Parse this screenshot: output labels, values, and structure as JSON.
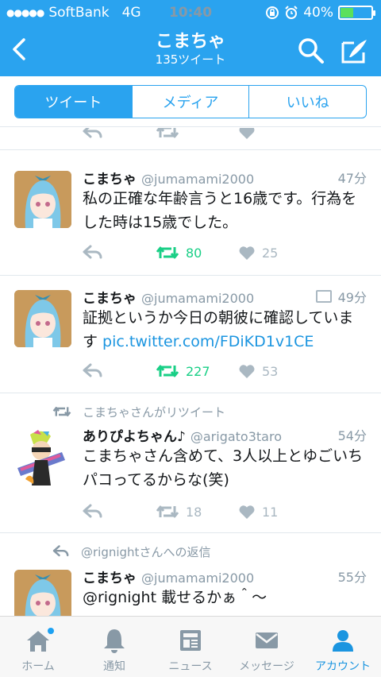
{
  "status_bar": {
    "signal": "●●●●●",
    "carrier": "SoftBank",
    "network": "4G",
    "time": "10:40",
    "battery": "40%",
    "battery_level": 0.4
  },
  "nav": {
    "title": "こまちゃ",
    "subtitle": "135ツイート"
  },
  "segments": [
    {
      "label": "ツイート",
      "active": true
    },
    {
      "label": "メディア",
      "active": false
    },
    {
      "label": "いいね",
      "active": false
    }
  ],
  "tweets": [
    {
      "name": "こまちゃ",
      "handle": "@jumamami2000",
      "time": "47分",
      "text": "私の正確な年齢言うと16歳です。行為をした時は15歳でした。",
      "retweets": "80",
      "likes": "25"
    },
    {
      "name": "こまちゃ",
      "handle": "@jumamami2000",
      "time": "49分",
      "text": "証拠というか今日の朝彼に確認しています ",
      "link": "pic.twitter.com/FDiKD1v1CE",
      "retweets": "227",
      "likes": "53"
    },
    {
      "context": "こまちゃさんがリツイート",
      "name": "ありぴよちゃん♪",
      "handle": "@arigato3taro",
      "time": "54分",
      "text": "こまちゃさん含めて、3人以上とゆごいちパコってるからな(笑)",
      "retweets": "18",
      "likes": "11"
    },
    {
      "context": "@rignightさんへの返信",
      "name": "こまちゃ",
      "handle": "@jumamami2000",
      "time": "55分",
      "text": "@rignight 載せるかぁ＾〜"
    }
  ],
  "tabs": [
    {
      "label": "ホーム",
      "icon": "home-icon",
      "badge": true
    },
    {
      "label": "通知",
      "icon": "bell-icon"
    },
    {
      "label": "ニュース",
      "icon": "news-icon"
    },
    {
      "label": "メッセージ",
      "icon": "envelope-icon"
    },
    {
      "label": "アカウント",
      "icon": "person-icon",
      "active": true
    }
  ],
  "colors": {
    "brand": "#2aa3ef",
    "retweet_active": "#19cf86",
    "link": "#1b95e0",
    "muted": "#aab8c2"
  }
}
